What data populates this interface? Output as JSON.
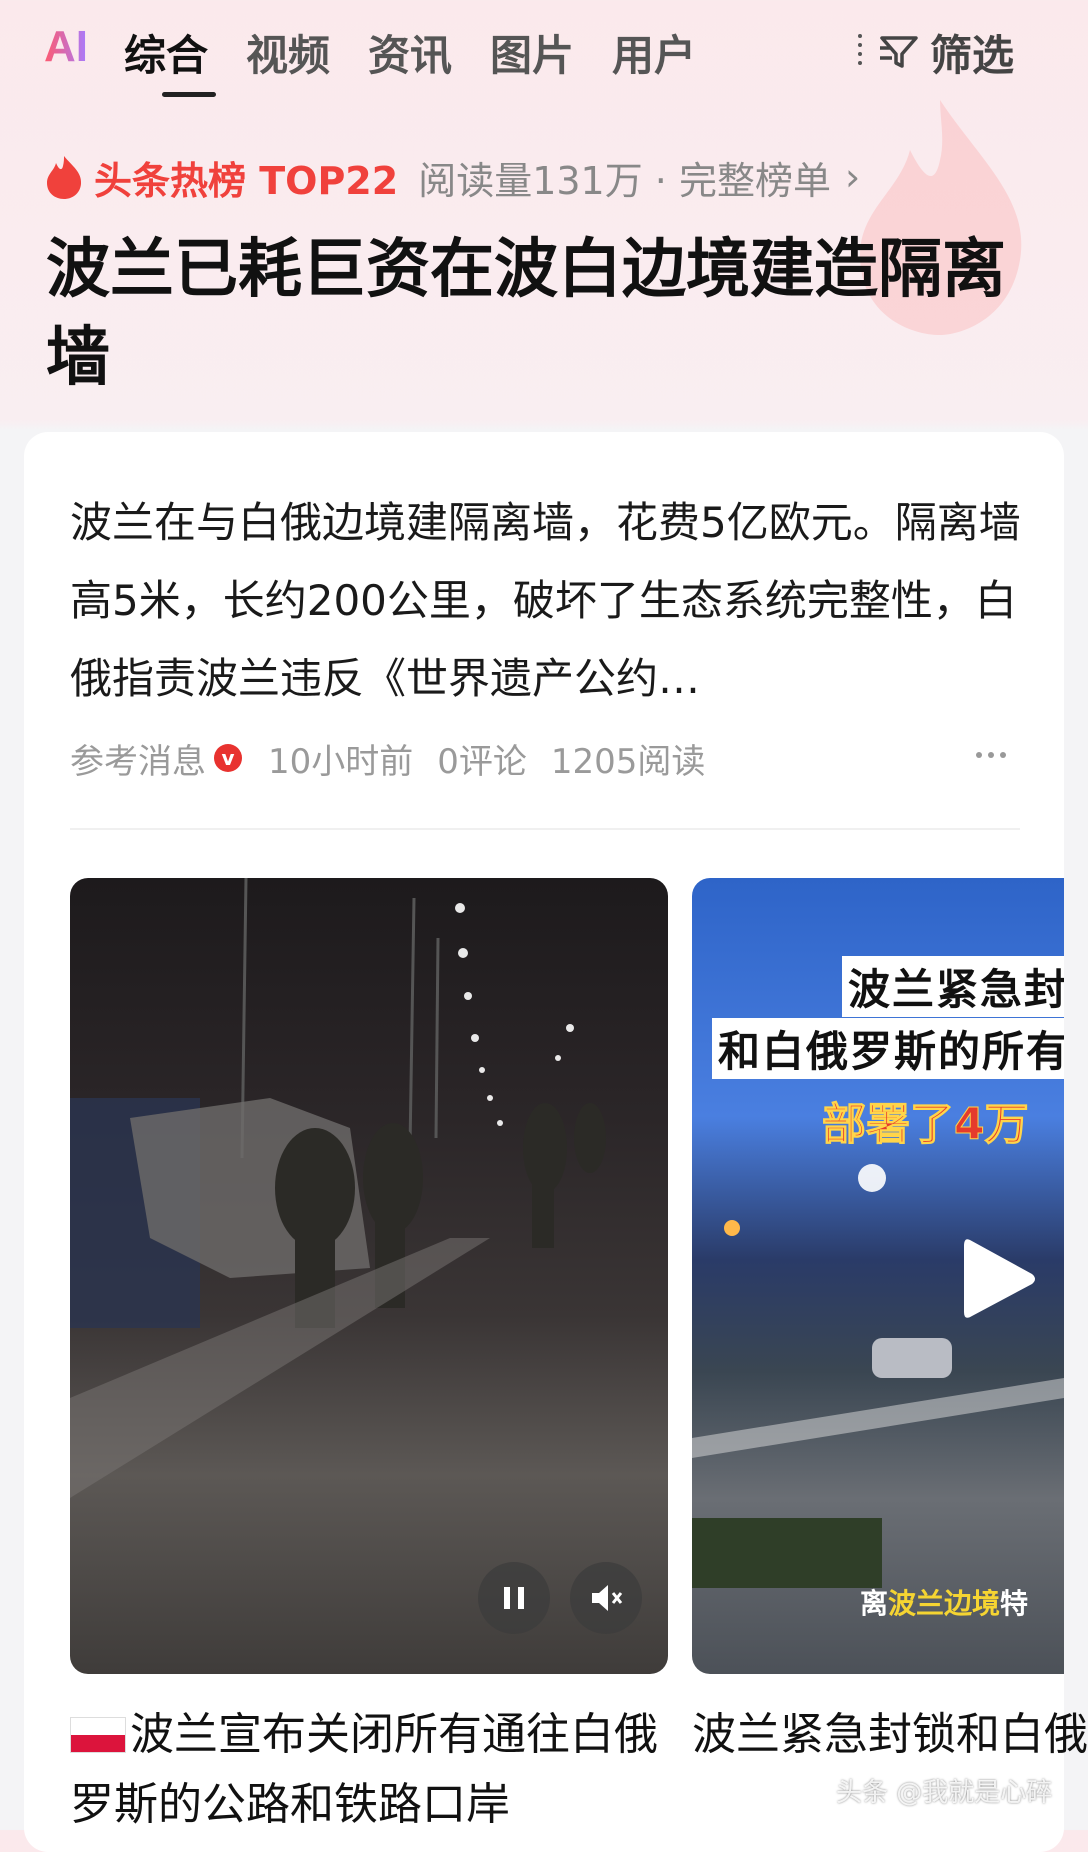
{
  "tabs": {
    "ai_label": "AI",
    "items": [
      "综合",
      "视频",
      "资讯",
      "图片",
      "用户"
    ],
    "active": "综合",
    "filter_label": "筛选"
  },
  "hot_rank": {
    "badge": "头条热榜 TOP22",
    "meta": "阅读量131万 · 完整榜单",
    "chevron": "›",
    "accent_color": "#f0413c"
  },
  "headline": "波兰已耗巨资在波白边境建造隔离墙",
  "article": {
    "summary": "波兰在与白俄边境建隔离墙，花费5亿欧元。隔离墙高5米，长约200公里，破坏了生态系统完整性，白俄指责波兰违反《世界遗产公约…",
    "source": "参考消息",
    "verified_badge": "v",
    "time": "10小时前",
    "comments": "0评论",
    "reads": "1205阅读"
  },
  "videos": [
    {
      "title": "波兰宣布关闭所有通往白俄罗斯的公路和铁路口岸",
      "flag": "poland-flag-icon",
      "controls": [
        "pause-icon",
        "mute-icon"
      ]
    },
    {
      "title": "波兰紧急封锁和白俄罗斯的所有边境口岸，进",
      "overlay_line1": "波兰紧急封",
      "overlay_line2": "和白俄罗斯的所有",
      "overlay_line3": "部署了4万",
      "tag_a": "离",
      "tag_b": "波兰边境",
      "tag_c": "特"
    }
  ],
  "watermark": "头条 @我就是心碎"
}
